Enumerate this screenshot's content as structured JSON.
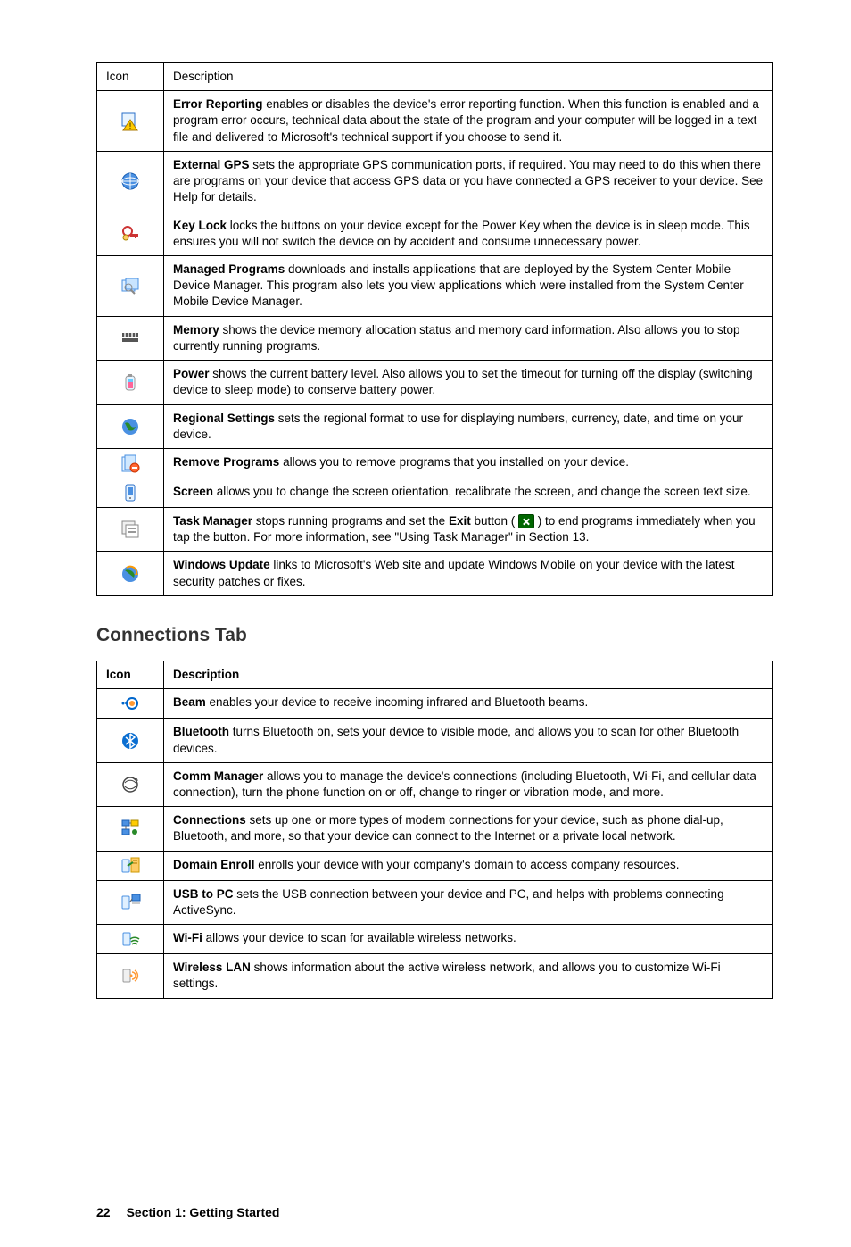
{
  "table1": {
    "header": {
      "icon": "Icon",
      "desc": "Description"
    },
    "rows": [
      {
        "icon": "error-reporting-icon",
        "bold": "Error Reporting",
        "text": " enables or disables the device's error reporting function. When this function is enabled and a program error occurs, technical data about the state of the program and your computer will be logged in a text file and delivered to Microsoft's technical support if you choose to send it."
      },
      {
        "icon": "external-gps-icon",
        "bold": "External GPS",
        "text": " sets the appropriate GPS communication ports, if required. You may need to do this when there are programs on your device that access GPS data or you have connected a GPS receiver to your device. See Help for details."
      },
      {
        "icon": "key-lock-icon",
        "bold": "Key Lock",
        "text": " locks the buttons on your device except for the Power Key when the device is in sleep mode. This ensures you will not switch the device on by accident and consume unnecessary power."
      },
      {
        "icon": "managed-programs-icon",
        "bold": "Managed Programs",
        "text": " downloads and installs applications that are deployed by the System Center Mobile Device Manager. This program also lets you view applications which were installed from the System Center Mobile Device Manager."
      },
      {
        "icon": "memory-icon",
        "bold": "Memory",
        "text": " shows the device memory allocation status and memory card information. Also allows you to stop currently running programs."
      },
      {
        "icon": "power-icon",
        "bold": "Power",
        "text": " shows the current battery level. Also allows you to set the timeout for turning off the display (switching device to sleep mode) to conserve battery power."
      },
      {
        "icon": "regional-settings-icon",
        "bold": "Regional Settings",
        "text": " sets the regional format to use for displaying numbers, currency, date, and time on your device."
      },
      {
        "icon": "remove-programs-icon",
        "bold": "Remove Programs",
        "text": " allows you to remove programs that you installed on your device."
      },
      {
        "icon": "screen-icon",
        "bold": "Screen",
        "text": " allows you to change the screen orientation, recalibrate the screen, and change the screen text size."
      },
      {
        "icon": "task-manager-icon",
        "bold": "Task Manager",
        "text_pre": " stops running programs and set the ",
        "bold2": "Exit",
        "text_mid": " button ( ",
        "text_post": " ) to end programs immediately when you tap the button. For more information, see \"Using Task Manager\" in Section 13."
      },
      {
        "icon": "windows-update-icon",
        "bold": "Windows Update",
        "text": " links to Microsoft's Web site and update Windows Mobile on your device with the latest security patches or fixes."
      }
    ]
  },
  "heading": "Connections Tab",
  "table2": {
    "header": {
      "icon": "Icon",
      "desc": "Description"
    },
    "rows": [
      {
        "icon": "beam-icon",
        "bold": "Beam",
        "text": " enables your device to receive incoming infrared and Bluetooth beams."
      },
      {
        "icon": "bluetooth-icon",
        "bold": "Bluetooth",
        "text": " turns Bluetooth on, sets your device to visible mode, and allows you to scan for other Bluetooth devices."
      },
      {
        "icon": "comm-manager-icon",
        "bold": "Comm Manager",
        "text": " allows you to manage the device's connections (including Bluetooth, Wi-Fi, and cellular data connection), turn the phone function on or off, change to ringer or vibration mode, and more."
      },
      {
        "icon": "connections-icon",
        "bold": "Connections",
        "text": " sets up one or more types of modem connections for your device, such as phone dial-up, Bluetooth, and more, so that your device can connect to the Internet or a private local network."
      },
      {
        "icon": "domain-enroll-icon",
        "bold": "Domain Enroll",
        "text": " enrolls your device with your company's domain to access company resources."
      },
      {
        "icon": "usb-to-pc-icon",
        "bold": "USB to PC",
        "text": " sets the USB connection between your device and PC, and helps with problems connecting ActiveSync."
      },
      {
        "icon": "wifi-icon",
        "bold": "Wi-Fi",
        "text": " allows your device to scan for available wireless networks."
      },
      {
        "icon": "wireless-lan-icon",
        "bold": "Wireless LAN",
        "text": " shows information about the active wireless network, and allows you to customize Wi-Fi settings."
      }
    ]
  },
  "footer": {
    "page": "22",
    "section": "Section 1: Getting Started"
  }
}
